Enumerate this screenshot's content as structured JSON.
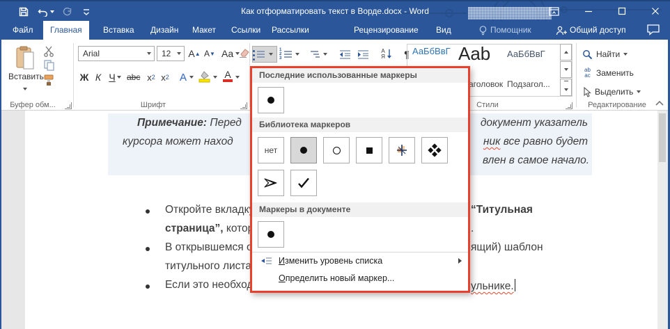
{
  "colors": {
    "titlebar": "#2b579a",
    "annotation_border": "#e8402c",
    "note_bg": "#eef3f9",
    "doc_text": "#3f3f3f"
  },
  "titlebar": {
    "title": "Как отформатировать текст в Ворде.docx - Word"
  },
  "tabs": [
    {
      "label": "Файл"
    },
    {
      "label": "Главная"
    },
    {
      "label": "Вставка"
    },
    {
      "label": "Дизайн"
    },
    {
      "label": "Макет"
    },
    {
      "label": "Ссылки"
    },
    {
      "label": "Рассылки"
    },
    {
      "label": "Рецензирование"
    },
    {
      "label": "Вид"
    },
    {
      "label": "Помощник"
    },
    {
      "label": "Общий доступ"
    }
  ],
  "ribbon": {
    "clipboard": {
      "paste": "Вставить",
      "group": "Буфер обм..."
    },
    "font": {
      "family": "Arial",
      "size": "12",
      "bold": "Ж",
      "italic": "К",
      "underline": "Ч",
      "strike": "abc",
      "script_x": "х",
      "sub2": "2",
      "sup2": "2",
      "case": "Aa",
      "effects_a": "А",
      "color_a": "А",
      "group": "Шрифт"
    },
    "paragraph": {
      "sort_a": "А",
      "sort_z": "Я",
      "pilcrow": "¶"
    },
    "styles": {
      "cells": [
        {
          "preview": "АаБбВвГ"
        },
        {
          "preview": "Aab",
          "label": "аголовок"
        },
        {
          "preview": "АаБбВвГ",
          "label": "Подзагол..."
        }
      ],
      "group": "Стили"
    },
    "editing": {
      "find": "Найти",
      "replace": "Заменить",
      "select": "Выделить",
      "group": "Редактирование"
    }
  },
  "bullet_menu": {
    "recent_header": "Последние использованные маркеры",
    "library_header": "Библиотека маркеров",
    "document_header": "Маркеры в документе",
    "none_label": "нет",
    "change_level_key": "И",
    "change_level_rest": "зменить уровень списка",
    "define_new_key": "О",
    "define_new_rest": "пределить новый маркер..."
  },
  "document": {
    "note": {
      "l1_bold": "Примечание:",
      "l1_left": " Перед",
      "l1_right": "документ указатель",
      "l2_left": "курсора может наход",
      "l2_right_marked": "ник",
      "l2_right": " все равно будет",
      "l3_right": "влен в самое начало."
    },
    "list": {
      "b1": "Откройте вкладку",
      "b1_right": "“Титульная",
      "b1c_bold": "страница”,",
      "b1c": " котора",
      "b1c_right": ".",
      "b2": "В открывшемся ок",
      "b2_right": "ящий) шаблон",
      "b2c": "титульного листа.",
      "b3": "Если это необходи",
      "b3_right": "ульнике."
    }
  }
}
